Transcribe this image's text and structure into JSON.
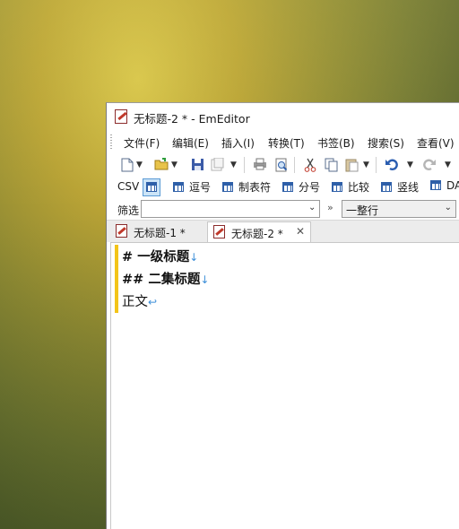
{
  "window": {
    "title": "无标题-2 * - EmEditor"
  },
  "menu": [
    {
      "label": "文件(F)"
    },
    {
      "label": "编辑(E)"
    },
    {
      "label": "插入(I)"
    },
    {
      "label": "转换(T)"
    },
    {
      "label": "书签(B)"
    },
    {
      "label": "搜索(S)"
    },
    {
      "label": "查看(V)"
    }
  ],
  "toolbar": {
    "icons": [
      "new-file-icon",
      "open-folder-icon",
      "save-icon",
      "save-all-icon",
      "print-icon",
      "print-preview-icon",
      "cut-icon",
      "copy-icon",
      "paste-icon",
      "undo-icon",
      "redo-icon"
    ]
  },
  "csvbar": {
    "label": "CSV",
    "buttons": [
      {
        "label": "逗号"
      },
      {
        "label": "制表符"
      },
      {
        "label": "分号"
      },
      {
        "label": "比较"
      },
      {
        "label": "竖线"
      },
      {
        "label": "DA"
      }
    ]
  },
  "filterbar": {
    "label": "筛选",
    "value": "",
    "mode_prefix": "»",
    "mode_value": "一整行"
  },
  "tabs": [
    {
      "label": "无标题-1 *",
      "active": false
    },
    {
      "label": "无标题-2 *",
      "active": true
    }
  ],
  "editor": {
    "lines": [
      {
        "text": "# 一级标题",
        "bold": true
      },
      {
        "text": "## 二集标题",
        "bold": true
      },
      {
        "text": "正文",
        "bold": false
      }
    ],
    "eol_glyph": "↓",
    "eof_glyph": "↩"
  },
  "colors": {
    "change_bar": "#f3c419",
    "eol_marker": "#3d8fd9",
    "csv_icon": "#2e5fa8"
  }
}
